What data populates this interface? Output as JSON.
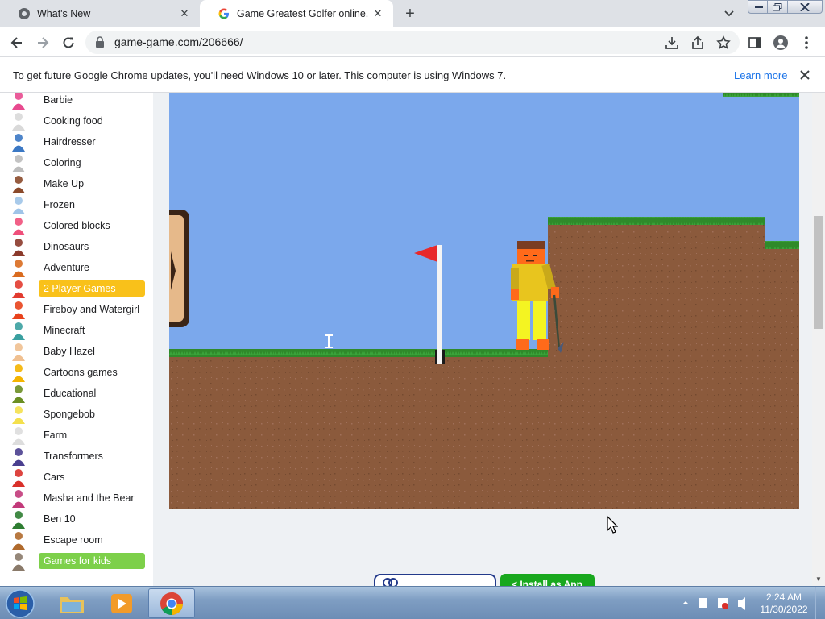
{
  "browser": {
    "tabs": [
      {
        "title": "What's New",
        "icon": "chrome-logo-icon",
        "active": false
      },
      {
        "title": "Game Greatest Golfer online. Play",
        "icon": "google-g-icon",
        "active": true
      }
    ],
    "url": "game-game.com/206666/"
  },
  "infobar": {
    "message": "To get future Google Chrome updates, you'll need Windows 10 or later. This computer is using Windows 7.",
    "link": "Learn more"
  },
  "sidebar": {
    "categories": [
      {
        "label": "Barbie",
        "icon": "barbie-icon",
        "color": "#e84a8f"
      },
      {
        "label": "Cooking food",
        "icon": "chef-icon",
        "color": "#d9d9d9"
      },
      {
        "label": "Hairdresser",
        "icon": "scissors-icon",
        "color": "#3b78c4"
      },
      {
        "label": "Coloring",
        "icon": "coloring-icon",
        "color": "#bdbdbd"
      },
      {
        "label": "Make Up",
        "icon": "makeup-icon",
        "color": "#8b4a2b"
      },
      {
        "label": "Frozen",
        "icon": "frozen-icon",
        "color": "#9fc4e8"
      },
      {
        "label": "Colored blocks",
        "icon": "blocks-icon",
        "color": "#ef4f7a"
      },
      {
        "label": "Dinosaurs",
        "icon": "dinosaur-icon",
        "color": "#8b3a2b"
      },
      {
        "label": "Adventure",
        "icon": "adventure-icon",
        "color": "#d96b1f"
      },
      {
        "label": "2 Player Games",
        "icon": "two-player-icon",
        "color": "#e23b2f",
        "highlight": "yellow"
      },
      {
        "label": "Fireboy and Watergirl",
        "icon": "fireboy-icon",
        "color": "#e8421c"
      },
      {
        "label": "Minecraft",
        "icon": "minecraft-icon",
        "color": "#3aa0a0"
      },
      {
        "label": "Baby Hazel",
        "icon": "baby-icon",
        "color": "#f0c090"
      },
      {
        "label": "Cartoons games",
        "icon": "cartoon-icon",
        "color": "#f4b400"
      },
      {
        "label": "Educational",
        "icon": "educational-icon",
        "color": "#6b8e23"
      },
      {
        "label": "Spongebob",
        "icon": "spongebob-icon",
        "color": "#f4e04d"
      },
      {
        "label": "Farm",
        "icon": "sheep-icon",
        "color": "#dddddd"
      },
      {
        "label": "Transformers",
        "icon": "robot-icon",
        "color": "#4a3f8f"
      },
      {
        "label": "Cars",
        "icon": "car-icon",
        "color": "#d9302a"
      },
      {
        "label": "Masha and the Bear",
        "icon": "masha-icon",
        "color": "#c23a7a"
      },
      {
        "label": "Ben 10",
        "icon": "ben10-icon",
        "color": "#2e7d32"
      },
      {
        "label": "Escape room",
        "icon": "door-icon",
        "color": "#b06a2c"
      },
      {
        "label": "Games for kids",
        "icon": "kids-icon",
        "color": "#8a7a6a",
        "highlight": "green"
      }
    ]
  },
  "buttons": {
    "install": "< Install as App"
  },
  "taskbar": {
    "time": "2:24 AM",
    "date": "11/30/2022"
  },
  "colors": {
    "sky": "#7ba8ec",
    "dirt": "#8b5a3c",
    "grass": "#2f8a2a",
    "flag": "#e8282a",
    "yellow_highlight": "#f9c11a",
    "green_highlight": "#7dd04a"
  }
}
